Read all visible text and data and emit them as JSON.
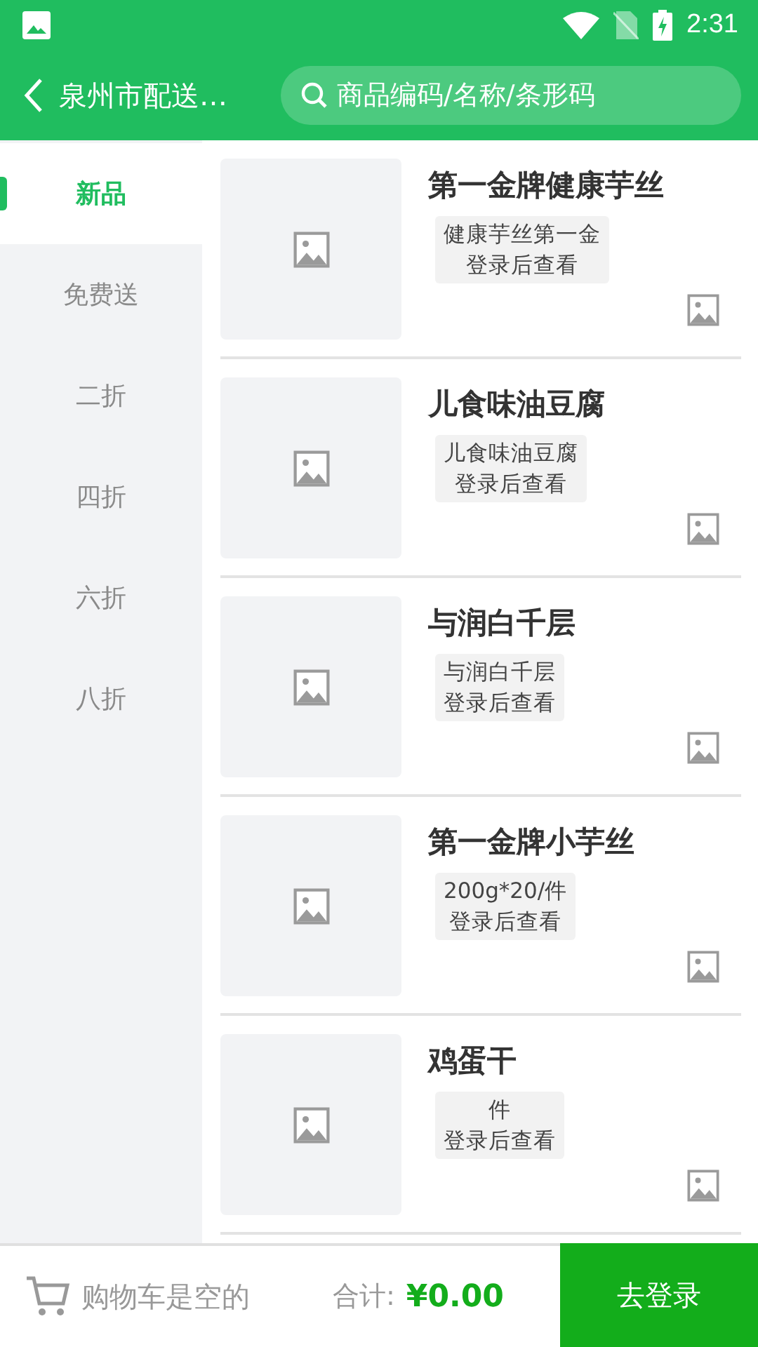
{
  "status_bar": {
    "time": "2:31"
  },
  "header": {
    "title": "泉州市配送…",
    "search": {
      "placeholder": "商品编码/名称/条形码"
    }
  },
  "sidebar": {
    "items": [
      {
        "label": "新品",
        "selected": true
      },
      {
        "label": "免费送",
        "selected": false
      },
      {
        "label": "二折",
        "selected": false
      },
      {
        "label": "四折",
        "selected": false
      },
      {
        "label": "六折",
        "selected": false
      },
      {
        "label": "八折",
        "selected": false
      }
    ]
  },
  "products": [
    {
      "name": "第一金牌健康芋丝",
      "spec": "健康芋丝第一金",
      "price_note": "登录后查看"
    },
    {
      "name": "儿食味油豆腐",
      "spec": "儿食味油豆腐",
      "price_note": "登录后查看"
    },
    {
      "name": "与润白千层",
      "spec": "与润白千层",
      "price_note": "登录后查看"
    },
    {
      "name": "第一金牌小芋丝",
      "spec": "200g*20/件",
      "price_note": "登录后查看"
    },
    {
      "name": "鸡蛋干",
      "spec": "件",
      "price_note": "登录后查看"
    }
  ],
  "cart_bar": {
    "cart_status": "购物车是空的",
    "total_label": "合计:",
    "total": "¥0.00",
    "login_button": "去登录"
  }
}
